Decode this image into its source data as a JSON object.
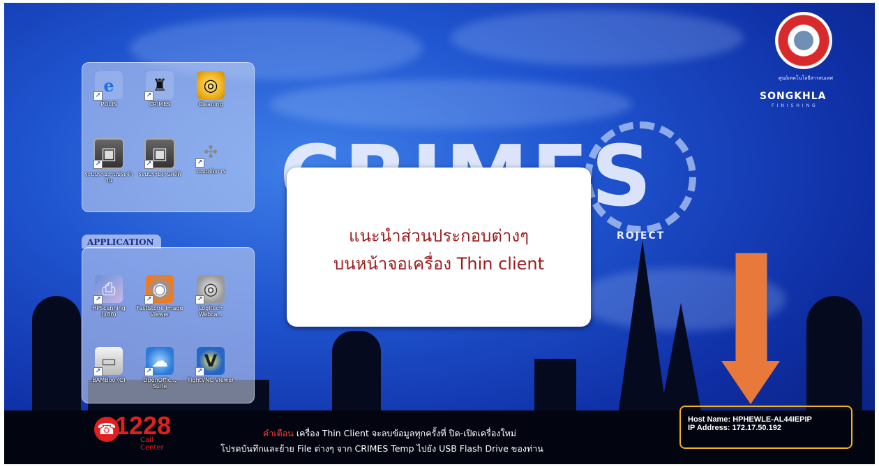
{
  "desktop_icons_top": [
    {
      "label": "POLIS",
      "icon": "internet-explorer-icon"
    },
    {
      "label": "CRIMES",
      "icon": "gis-person-icon"
    },
    {
      "label": "Cleaning",
      "icon": "cleaning-disc-icon"
    },
    {
      "label": "ระบบรายงานประจำวัน",
      "icon": "app-window-icon"
    },
    {
      "label": "ระบบรายงานสถิติ",
      "icon": "app-window-icon"
    },
    {
      "label": "ระบบจัดการ",
      "icon": "network-icon"
    }
  ],
  "application": {
    "title": "APPLICATION",
    "icons": [
      {
        "label": "HPScanning (x86)",
        "icon": "scanner-icon"
      },
      {
        "label": "FastStone Image Viewer",
        "icon": "faststone-eye-icon"
      },
      {
        "label": "Logitech Webca...",
        "icon": "webcam-icon"
      },
      {
        "label": "BAMBoo (C)",
        "icon": "drive-icon"
      },
      {
        "label": "OpenOffic... Suite",
        "icon": "openoffice-icon"
      },
      {
        "label": "TightVNC Viewer",
        "icon": "vnc-icon"
      }
    ]
  },
  "background": {
    "brand": "CRIMES",
    "project_left": "RO",
    "project_right": "ROJECT"
  },
  "popup": {
    "line1": "แนะนำส่วนประกอบต่างๆ",
    "line2": "บนหน้าจอเครื่อง Thin client"
  },
  "logo": {
    "seal_caption": "ศูนย์เทคโนโลยีสารสนเทศ",
    "company": "SONGKHLA",
    "company_sub": "FINISHING"
  },
  "host_info": {
    "host_label": "Host Name:",
    "host_value": "HPHEWLE-AL44IEPIP",
    "ip_label": "IP Address:",
    "ip_value": "172.17.50.192"
  },
  "call_center": {
    "number": "1228",
    "label": "Call Center"
  },
  "notice": {
    "warning_label": "คำเตือน",
    "line1": "เครื่อง Thin Client จะลบข้อมูลทุกครั้งที่ ปิด-เปิดเครื่องใหม่",
    "line2": "โปรดบันทึกและย้าย File ต่างๆ จาก CRIMES Temp ไปยัง USB Flash Drive ของท่าน"
  },
  "colors": {
    "arrow": "#e8793a",
    "host_border": "#f2b21b",
    "popup_text": "#9c1c1c"
  }
}
